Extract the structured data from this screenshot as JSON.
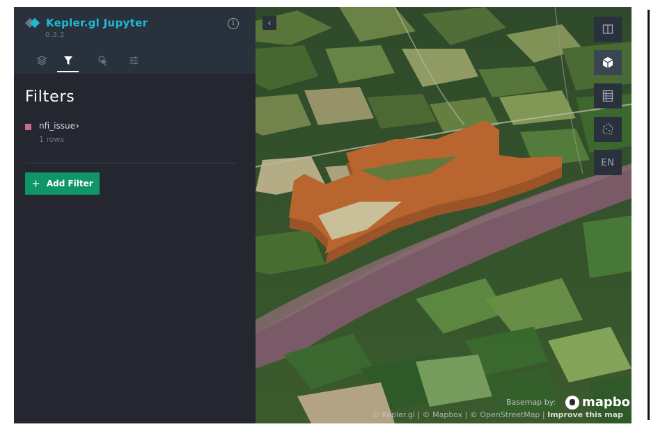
{
  "app": {
    "title": "Kepler.gl Jupyter",
    "version": "0.3.2"
  },
  "sidebar": {
    "tabs": [
      {
        "name": "layers",
        "icon": "layers-icon",
        "active": false
      },
      {
        "name": "filters",
        "icon": "filter-icon",
        "active": true
      },
      {
        "name": "interactions",
        "icon": "cursor-icon",
        "active": false
      },
      {
        "name": "map-style",
        "icon": "settings-sliders-icon",
        "active": false
      }
    ],
    "panel_title": "Filters",
    "dataset": {
      "name": "nfi_issue",
      "rows_label": "1 rows",
      "color": "#cc6b8a"
    },
    "add_filter_label": "Add Filter",
    "add_filter_icon": "+"
  },
  "map": {
    "collapse_glyph": "‹",
    "controls": [
      {
        "name": "split-map",
        "icon": "split-map-icon"
      },
      {
        "name": "3d-view",
        "icon": "cube-icon",
        "active": true
      },
      {
        "name": "legend",
        "icon": "legend-icon"
      },
      {
        "name": "draw",
        "icon": "polygon-draw-icon"
      },
      {
        "name": "language",
        "label": "EN"
      }
    ],
    "basemap_by": "Basemap by:",
    "brand": "mapbo",
    "attribution_text": "© Kepler.gl | © Mapbox | © OpenStreetMap | ",
    "attribution_link": "Improve this map"
  },
  "colors": {
    "accent": "#1fbad6",
    "button_green": "#0f9668",
    "sidebar_bg": "#242730",
    "header_bg": "#29323c",
    "polygon_fill": "#a0552a"
  }
}
